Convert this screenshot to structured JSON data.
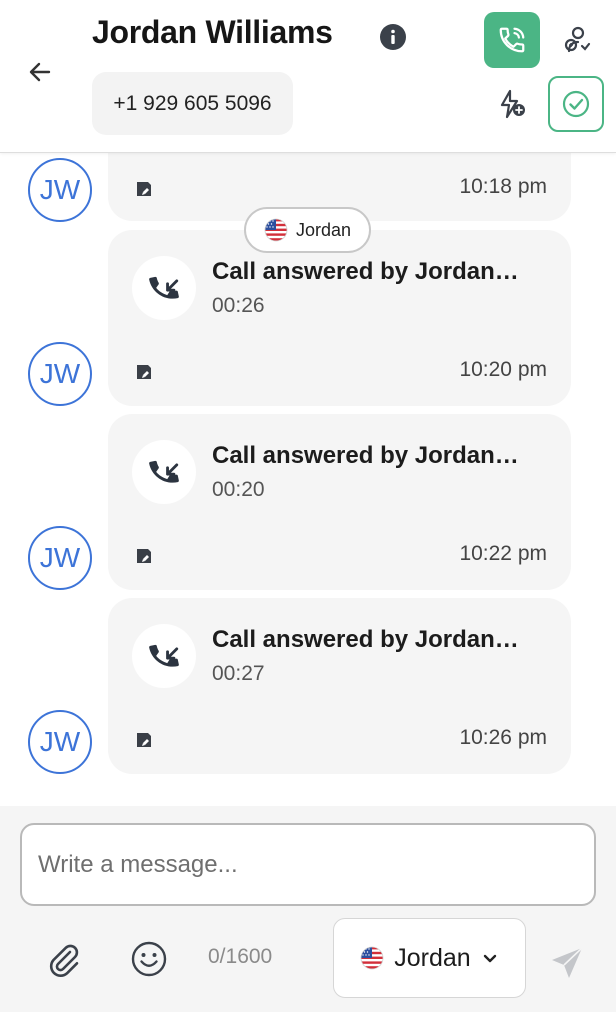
{
  "header": {
    "contact_name": "Jordan Williams",
    "phone_number": "+1 929 605 5096",
    "accent_color": "#4bb585",
    "icons": {
      "back": "arrow-left-icon",
      "info": "info-icon",
      "call": "phone-call-icon",
      "assign": "assign-user-icon",
      "shortcuts": "lightning-add-icon",
      "resolve": "check-circle-icon"
    }
  },
  "conversation": {
    "avatar_initials": "JW",
    "avatar_color": "#3d74d8",
    "agent_chip": {
      "label": "Jordan",
      "flag": "us-flag-icon"
    },
    "messages": [
      {
        "time": "10:18 pm"
      },
      {
        "title": "Call answered by Jordan…",
        "duration": "00:26",
        "time": "10:20 pm"
      },
      {
        "title": "Call answered by Jordan…",
        "duration": "00:20",
        "time": "10:22 pm"
      },
      {
        "title": "Call answered by Jordan…",
        "duration": "00:27",
        "time": "10:26 pm"
      }
    ]
  },
  "composer": {
    "placeholder": "Write a message...",
    "char_count": "0/1600",
    "sender": "Jordan",
    "icons": {
      "attach": "paperclip-icon",
      "emoji": "smiley-icon",
      "sender_flag": "us-flag-icon",
      "dropdown": "chevron-down-icon",
      "send": "send-icon"
    }
  }
}
